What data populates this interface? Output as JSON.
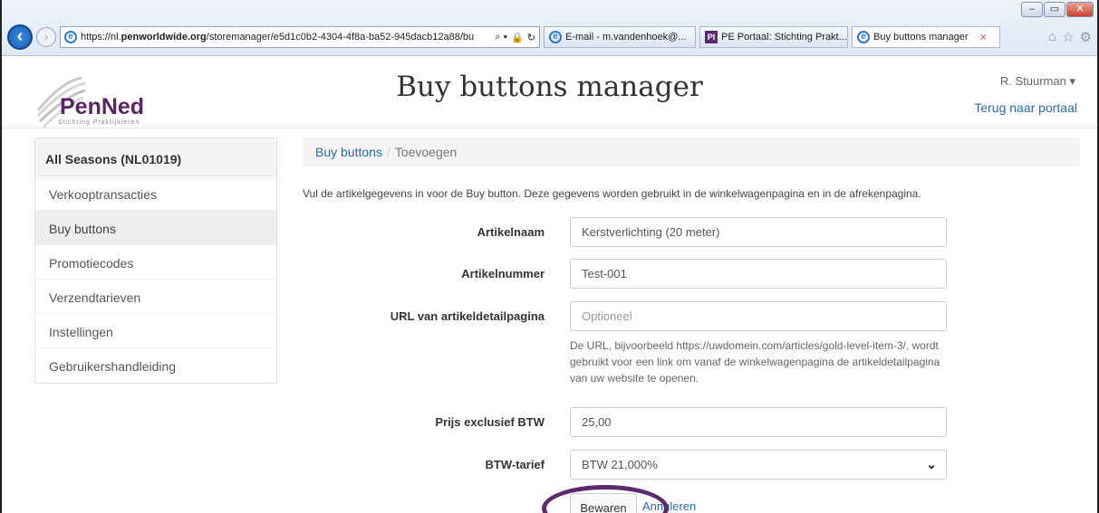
{
  "browser": {
    "address_prefix": "https://nl.",
    "address_domain": "penworldwide.org",
    "address_rest": "/storemanager/e5d1c0b2-4304-4f8a-ba52-945dacb12a88/bu",
    "tabs": [
      {
        "label": "E-mail - m.vandenhoek@...",
        "icon": "ie-icon"
      },
      {
        "label": "PE Portaal: Stichting Prakt...",
        "icon": "pi-icon"
      },
      {
        "label": "Buy buttons manager",
        "icon": "ie-icon",
        "active": true
      }
    ]
  },
  "header": {
    "logo_text": "PenNed",
    "logo_subtext": "Stichting Praktijkleren",
    "title": "Buy buttons manager",
    "user": "R. Stuurman ▾",
    "portal_link": "Terug naar portaal"
  },
  "sidebar": {
    "heading": "All Seasons (NL01019)",
    "items": [
      {
        "label": "Verkooptransacties"
      },
      {
        "label": "Buy buttons",
        "active": true
      },
      {
        "label": "Promotiecodes"
      },
      {
        "label": "Verzendtarieven"
      },
      {
        "label": "Instellingen"
      },
      {
        "label": "Gebruikershandleiding"
      }
    ]
  },
  "breadcrumb": {
    "link": "Buy buttons",
    "separator": "/",
    "current": "Toevoegen"
  },
  "form": {
    "intro": "Vul de artikelgegevens in voor de Buy button. Deze gegevens worden gebruikt in de winkelwagenpagina en in de afrekenpagina.",
    "article_name_label": "Artikelnaam",
    "article_name_value": "Kerstverlichting (20 meter)",
    "article_number_label": "Artikelnummer",
    "article_number_value": "Test-001",
    "url_label": "URL van artikeldetailpagina",
    "url_placeholder": "Optioneel",
    "url_help": "De URL, bijvoorbeeld https://uwdomein.com/articles/gold-level-item-3/, wordt gebruikt voor een link om vanaf de winkelwagenpagina de artikeldetailpagina van uw website te openen.",
    "price_label": "Prijs exclusief BTW",
    "price_value": "25,00",
    "vat_label": "BTW-tarief",
    "vat_value": "BTW 21,000%",
    "save_label": "Bewaren",
    "cancel_label": "Annuleren"
  },
  "colors": {
    "brand": "#5b2465",
    "link": "#2a6aa8",
    "highlight": "#5b2a6e"
  }
}
